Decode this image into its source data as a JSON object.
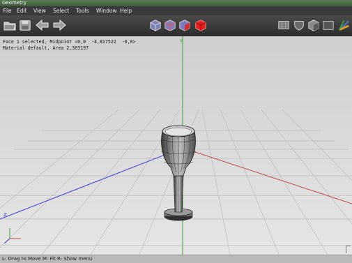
{
  "window": {
    "title": "Geometry"
  },
  "menu": {
    "items": [
      "File",
      "Edit",
      "View",
      "Select",
      "Tools",
      "Window",
      "Help"
    ]
  },
  "toolbar": {
    "left_icons": [
      "open-folder-icon",
      "save-disk-icon",
      "undo-arrow-icon",
      "redo-arrow-icon"
    ],
    "center_icons": [
      "view-mode-icon",
      "view-mode-icon",
      "view-mode-icon",
      "solid-cube-icon"
    ],
    "right_icons": [
      "texture-icon",
      "shield-icon",
      "cube-shaded-icon",
      "flat-icon",
      "axes-icon"
    ],
    "accent_red": "#e02020",
    "accent_blue": "#4b6db0"
  },
  "viewport": {
    "info_line_1": "Face 1 selected, Midpoint <0,0  -4,817522  -0,0>",
    "info_line_2": "Material default, Area 2,303197",
    "axis_y_label": "Y",
    "axis_z_label": "Z",
    "axis_colors": {
      "x": "#c04848",
      "y": "#3aa03a",
      "z": "#3a3ad0"
    }
  },
  "status": {
    "hint": "L: Drag to Move   M: Fit   R: Show menu"
  }
}
